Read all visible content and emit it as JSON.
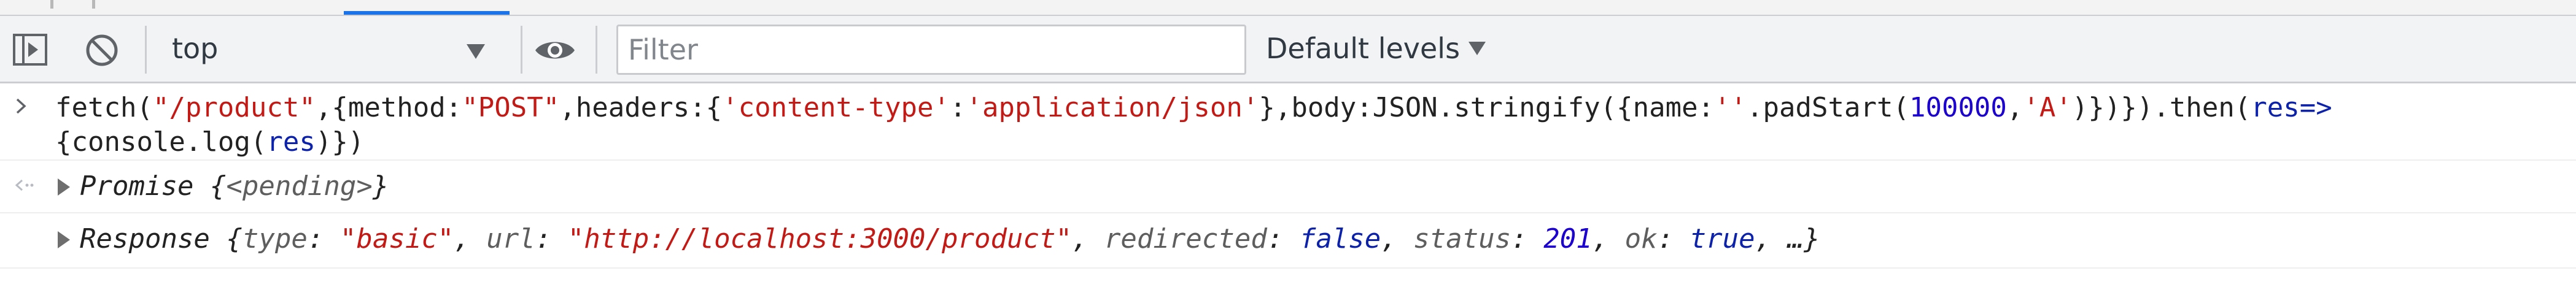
{
  "toolbar": {
    "context": "top",
    "filter_placeholder": "Filter",
    "levels_label": "Default levels"
  },
  "console": {
    "input_line1": {
      "t1": "fetch(",
      "t2": "\"/product\"",
      "t3": ",{method:",
      "t4": "\"POST\"",
      "t5": ",headers:{",
      "t6": "'content-type'",
      "t7": ":",
      "t8": "'application/json'",
      "t9": "},body:JSON.stringify({name:",
      "t10": "''",
      "t11": ".padStart(",
      "t12": "100000",
      "t13": ",",
      "t14": "'A'",
      "t15": ")})}).then(",
      "t16": "res",
      "t17": "=>"
    },
    "input_line2": {
      "t1": "{console.log(",
      "t2": "res",
      "t3": ")})"
    },
    "result": {
      "name": "Promise",
      "open": " {",
      "state": "<pending>",
      "close": "}"
    },
    "log": {
      "name": "Response",
      "open": " {",
      "k1": "type",
      "v1": "\"basic\"",
      "k2": "url",
      "v2": "\"http://localhost:3000/product\"",
      "k3": "redirected",
      "v3": "false",
      "k4": "status",
      "v4": "201",
      "k5": "ok",
      "v5": "true",
      "rest": ", …}"
    }
  }
}
